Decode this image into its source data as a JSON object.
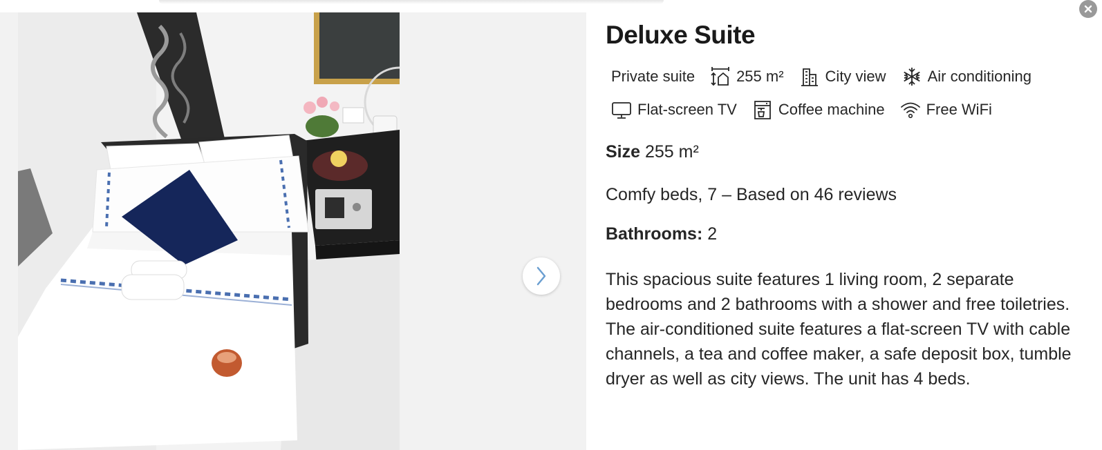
{
  "room": {
    "title": "Deluxe Suite",
    "facilities": [
      {
        "icon": "none",
        "label": "Private suite"
      },
      {
        "icon": "room-size-icon",
        "label": "255 m²"
      },
      {
        "icon": "city-view-icon",
        "label": "City view"
      },
      {
        "icon": "snowflake-icon",
        "label": "Air conditioning"
      },
      {
        "icon": "tv-icon",
        "label": "Flat-screen TV"
      },
      {
        "icon": "coffee-machine-icon",
        "label": "Coffee machine"
      },
      {
        "icon": "wifi-icon",
        "label": "Free WiFi"
      }
    ],
    "size_label": "Size",
    "size_value": "255 m²",
    "beds_text": "Comfy beds, 7 – Based on 46 reviews",
    "bathrooms_label": "Bathrooms:",
    "bathrooms_value": "2",
    "description": "This spacious suite features 1 living room, 2 separate bedrooms and 2 bathrooms with a shower and free toiletries. The air-conditioned suite features a flat-screen TV with cable channels, a tea and coffee maker, a safe deposit box, tumble dryer as well as city views. The unit has 4 beds."
  },
  "gallery": {
    "next_icon": "chevron-right-icon",
    "close_icon": "close-icon"
  },
  "colors": {
    "gallery_bg": "#f2f2f2",
    "next_chevron": "#6b9fd1",
    "close_bg": "#999999",
    "text": "#262626"
  }
}
